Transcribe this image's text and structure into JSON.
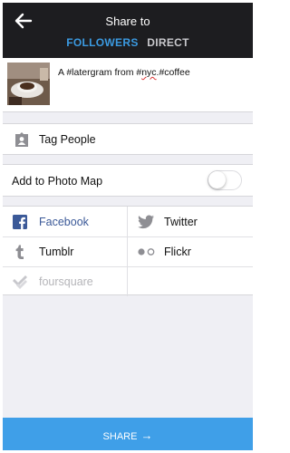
{
  "header": {
    "title": "Share to",
    "tabs": [
      {
        "label": "FOLLOWERS",
        "active": true
      },
      {
        "label": "DIRECT",
        "active": false
      }
    ]
  },
  "caption": {
    "prefix": "A #latergram from #",
    "misspelled": "nyc",
    "suffix": ".#coffee"
  },
  "tag_people": {
    "label": "Tag People",
    "icon": "tag-people-icon"
  },
  "photo_map": {
    "label": "Add to Photo Map",
    "enabled": false
  },
  "share_targets": [
    {
      "label": "Facebook",
      "icon": "facebook-icon",
      "color": "#3b5998"
    },
    {
      "label": "Twitter",
      "icon": "twitter-icon",
      "color": "#111111"
    },
    {
      "label": "Tumblr",
      "icon": "tumblr-icon",
      "color": "#111111"
    },
    {
      "label": "Flickr",
      "icon": "flickr-icon",
      "color": "#111111"
    },
    {
      "label": "foursquare",
      "icon": "foursquare-icon",
      "color": "#b5b5b9"
    }
  ],
  "share_button": {
    "label": "SHARE",
    "arrow": "→"
  },
  "colors": {
    "accent": "#3f9fe8",
    "header_bg": "#1d1d20",
    "facebook": "#3b5998"
  }
}
